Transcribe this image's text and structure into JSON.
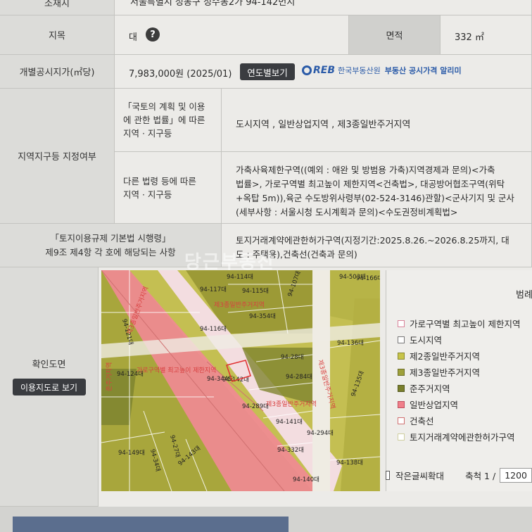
{
  "top_row": {
    "label": "소재지",
    "value": "서울특별시 성동구 성수동2가 94-142번지"
  },
  "jimok": {
    "label": "지목",
    "value": "대",
    "help_icon": "question-circle-icon",
    "area_label": "면적",
    "area_value": "332 ㎡"
  },
  "price": {
    "label": "개별공시지가(㎡당)",
    "value": "7,983,000원 (2025/01)",
    "button": "연도별보기",
    "reb_logo": "REB",
    "reb_text": "한국부동산원",
    "reb_service": "부동산 공시가격 알리미"
  },
  "zoning": {
    "label": "지역지구등 지정여부",
    "law1_label": [
      "「국토의 계획 및 이용",
      "에 관한 법률」에 따른",
      "지역 · 지구등"
    ],
    "law1_value": "도시지역 , 일반상업지역 , 제3종일반주거지역",
    "law2_label": [
      "다른 법령 등에 따른",
      "지역 · 지구등"
    ],
    "law2_value": [
      "가축사육제한구역((예외 : 애완 및 방범용 가축)지역경제과 문의)<가축",
      "법률>, 가로구역별 최고높이 제한지역<건축법>, 대공방어협조구역(위탁",
      "+옥탑 5m)),육군 수도방위사령부(02-524-3146)관할)<군사기지 및 군사",
      "(세부사항 : 서울시청 도시계획과 문의)<수도권정비계획법>"
    ]
  },
  "enforcement": {
    "label": [
      "「토지이용규제 기본법 시행령」",
      "제9조 제4항 각 호에 해당되는 사항"
    ],
    "value": [
      "토지거래계약에관한허가구역(지정기간:2025.8.26.~2026.8.25까지, 대",
      "도 : 주택용),건축선(건축과 문의)"
    ]
  },
  "map_section": {
    "label": "확인도면",
    "button": "이용지도로 보기",
    "parcels": [
      "94-117대",
      "94-115대",
      "94-107대",
      "94-121대",
      "94-116대",
      "94-354대",
      "94-136대",
      "94-124대",
      "94-344도",
      "94-142대",
      "94-28대",
      "94-284대",
      "94-289대",
      "94-135대",
      "94-141대",
      "94-34대",
      "94-27대",
      "94-149대",
      "94-143대",
      "94-294대",
      "94-332대",
      "94-138대",
      "94-140대",
      "94-503대",
      "94-114대",
      "94-166대"
    ],
    "map_labels": [
      "제3종일반주거지역",
      "가로구역별 최고높이 제한지역",
      "제3종일반주거지역",
      "제3종일반주거지역",
      "준주거지역",
      "제3종일반주거지역"
    ]
  },
  "legend": {
    "title": "범례",
    "items": [
      {
        "label": "가로구역별 최고높이 제한지역",
        "color": "#ffffff",
        "border": "#d9839a"
      },
      {
        "label": "도시지역",
        "color": "#ffffff",
        "border": "#777777"
      },
      {
        "label": "제2종일반주거지역",
        "color": "#c7c44a",
        "border": "#8a8a30"
      },
      {
        "label": "제3종일반주거지역",
        "color": "#9ea03a",
        "border": "#6e702a"
      },
      {
        "label": "준주거지역",
        "color": "#7a7f2c",
        "border": "#555a20"
      },
      {
        "label": "일반상업지역",
        "color": "#f07f8a",
        "border": "#c05060"
      },
      {
        "label": "건축선",
        "color": "#ffffff",
        "border": "#d07070"
      },
      {
        "label": "토지거래계약에관한허가구역",
        "color": "#ffffff",
        "border": "#cfcfa0"
      }
    ]
  },
  "bottom": {
    "small_text_label": "작은글씨확대",
    "scale_label": "축척 1 /",
    "scale_value": "1200"
  },
  "watermark": "당근부동산"
}
